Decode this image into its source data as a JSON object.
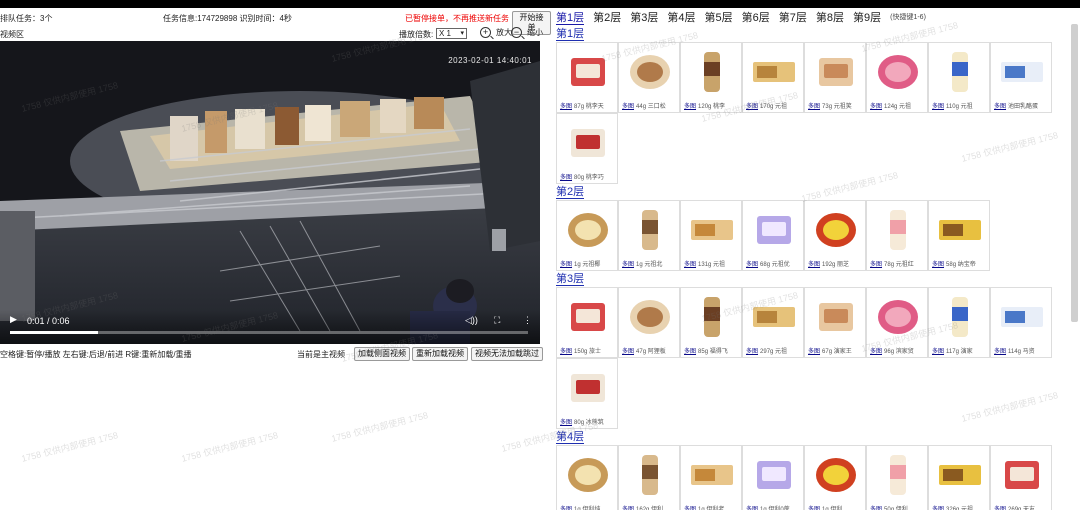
{
  "header": {
    "queue_text": "排队任务：3个",
    "task_text": "任务信息:174729898 识别时间：4秒",
    "warning_text": "已暂停接单，不再推送新任务",
    "start_button": "开始接单"
  },
  "video_bar": {
    "area_label": "视频区",
    "rate_label": "播放倍数:",
    "rate_value": "X 1",
    "zoom_in": "放大",
    "zoom_out": "缩小"
  },
  "video": {
    "timestamp": "2023-02-01  14:40:01",
    "time_display": "0:01 / 0:06",
    "progress": 0.17
  },
  "below": {
    "hint": "空格键:暂停/播放 左右键:后退/前进 R键:重新加载/重播",
    "current": "当前是主视频",
    "btn_side": "加载侧面视频",
    "btn_reload": "重新加载视频",
    "btn_cannot": "视频无法加载跳过"
  },
  "tabs": {
    "items": [
      "第1层",
      "第2层",
      "第3层",
      "第4层",
      "第5层",
      "第6层",
      "第7层",
      "第8层",
      "第9层"
    ],
    "shortcut": "(快捷键1-6)"
  },
  "sections": [
    {
      "title": "第1层",
      "items": [
        {
          "link": "多图",
          "text": "87g 桃李天"
        },
        {
          "link": "多图",
          "text": "44g 三口松"
        },
        {
          "link": "多图",
          "text": "120g 桃李"
        },
        {
          "link": "多图",
          "text": "170g 元祖"
        },
        {
          "link": "多图",
          "text": "73g 元祖笑"
        },
        {
          "link": "多图",
          "text": "124g 元祖"
        },
        {
          "link": "多图",
          "text": "110g 元祖"
        },
        {
          "link": "多图",
          "text": "池田乳酪蛋"
        },
        {
          "link": "多图",
          "text": "80g 桃李巧"
        }
      ]
    },
    {
      "title": "第2层",
      "items": [
        {
          "link": "多图",
          "text": "1g 元祖椰"
        },
        {
          "link": "多图",
          "text": "1g 元祖北"
        },
        {
          "link": "多图",
          "text": "131g 元祖"
        },
        {
          "link": "多图",
          "text": "68g 元祖优"
        },
        {
          "link": "多图",
          "text": "192g 丽芝"
        },
        {
          "link": "多图",
          "text": "78g 元祖红"
        },
        {
          "link": "多图",
          "text": "58g 纳宝帝"
        }
      ]
    },
    {
      "title": "第3层",
      "items": [
        {
          "link": "多图",
          "text": "150g 旅士"
        },
        {
          "link": "多图",
          "text": "47g 阿狸板"
        },
        {
          "link": "多图",
          "text": "85g 福得飞"
        },
        {
          "link": "多图",
          "text": "297g 元祖"
        },
        {
          "link": "多图",
          "text": "67g 演家王"
        },
        {
          "link": "多图",
          "text": "96g 滨家贸"
        },
        {
          "link": "多图",
          "text": "117g 演家"
        },
        {
          "link": "多图",
          "text": "114g 马资"
        },
        {
          "link": "多图",
          "text": "80g 冰熊筑"
        }
      ]
    },
    {
      "title": "第4层",
      "items": [
        {
          "link": "多图",
          "text": "1g 伊利纯"
        },
        {
          "link": "多图",
          "text": "162g 伊利"
        },
        {
          "link": "多图",
          "text": "1g 伊利老"
        },
        {
          "link": "多图",
          "text": "1g 伊利0蔗"
        },
        {
          "link": "多图",
          "text": "1g 伊利"
        },
        {
          "link": "多图",
          "text": "50g 伊利"
        },
        {
          "link": "多图",
          "text": "326g 元祖"
        },
        {
          "link": "多图",
          "text": "269g 天友"
        }
      ]
    }
  ],
  "watermark": "1758 仅供内部使用 1758",
  "colors": {
    "section": "#1f2fb0",
    "warning": "#e00000",
    "link": "#0a0a8a"
  }
}
